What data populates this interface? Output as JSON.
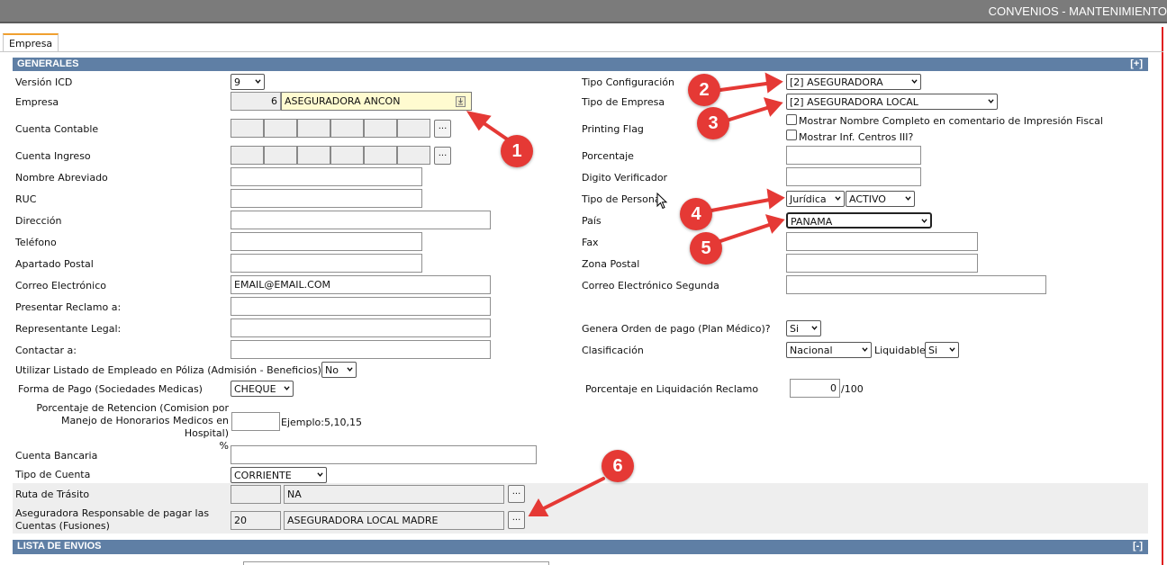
{
  "header": {
    "title": "CONVENIOS - MANTENIMIENTO"
  },
  "tabs": [
    {
      "label": "Empresa"
    }
  ],
  "sections": {
    "generales": {
      "title": "GENERALES",
      "toggle": "[+]"
    },
    "lista_envios": {
      "title": "LISTA DE ENVIOS",
      "toggle": "[-]"
    }
  },
  "left": {
    "version_icd": {
      "label": "Versión ICD",
      "value": "9"
    },
    "empresa": {
      "label": "Empresa",
      "code": "6",
      "name": "ASEGURADORA ANCON"
    },
    "cuenta_contable": {
      "label": "Cuenta Contable"
    },
    "cuenta_ingreso": {
      "label": "Cuenta Ingreso"
    },
    "nombre_abreviado": {
      "label": "Nombre Abreviado",
      "value": ""
    },
    "ruc": {
      "label": "RUC",
      "value": ""
    },
    "direccion": {
      "label": "Dirección",
      "value": ""
    },
    "telefono": {
      "label": "Teléfono",
      "value": ""
    },
    "apartado_postal": {
      "label": "Apartado Postal",
      "value": ""
    },
    "correo": {
      "label": "Correo Electrónico",
      "value": "EMAIL@EMAIL.COM"
    },
    "presentar_reclamo": {
      "label": "Presentar Reclamo a:",
      "value": ""
    },
    "representante_legal": {
      "label": "Representante Legal:",
      "value": ""
    },
    "contactar": {
      "label": "Contactar a:",
      "value": ""
    },
    "listado_empleado": {
      "label": "Utilizar Listado de Empleado en Póliza (Admisión - Beneficios):",
      "value": "No"
    },
    "forma_pago": {
      "label": "Forma de Pago (Sociedades Medicas)",
      "value": "CHEQUE"
    },
    "porcentaje_retencion": {
      "label_line1": "Porcentaje de Retencion (Comision por",
      "label_line2": "Manejo de Honorarios Medicos en Hospital)",
      "label_line3": "%",
      "value": "",
      "example": "Ejemplo:5,10,15"
    },
    "cuenta_bancaria": {
      "label": "Cuenta Bancaria",
      "value": ""
    },
    "tipo_cuenta": {
      "label": "Tipo de Cuenta",
      "value": "CORRIENTE"
    },
    "ruta_transito": {
      "label": "Ruta de Trásito",
      "code": "",
      "name": "NA"
    },
    "aseguradora_responsable": {
      "label_line1": "Aseguradora Responsable de pagar las",
      "label_line2": "Cuentas (Fusiones)",
      "code": "20",
      "name": "ASEGURADORA LOCAL MADRE"
    },
    "browse_label": "..."
  },
  "right": {
    "tipo_configuracion": {
      "label": "Tipo Configuración",
      "value": "[2] ASEGURADORA"
    },
    "tipo_empresa": {
      "label": "Tipo de Empresa",
      "value": "[2] ASEGURADORA LOCAL"
    },
    "printing_flag": {
      "label": "Printing Flag",
      "opt1": "Mostrar Nombre Completo en comentario de Impresión Fiscal",
      "opt2": "Mostrar Inf. Centros III?"
    },
    "porcentaje": {
      "label": "Porcentaje",
      "value": ""
    },
    "digito_verificador": {
      "label": "Digito Verificador",
      "value": ""
    },
    "tipo_persona": {
      "label": "Tipo de Persona",
      "value": "Jurídica",
      "estado": "ACTIVO"
    },
    "pais": {
      "label": "País",
      "value": "PANAMA"
    },
    "fax": {
      "label": "Fax",
      "value": ""
    },
    "zona_postal": {
      "label": "Zona Postal",
      "value": ""
    },
    "correo_segunda": {
      "label": "Correo Electrónico Segunda",
      "value": ""
    },
    "genera_orden": {
      "label": "Genera Orden de pago (Plan Médico)?",
      "value": "Si"
    },
    "clasificacion": {
      "label": "Clasificación",
      "value": "Nacional",
      "liquidable_label": "Liquidable",
      "liquidable_value": "Si"
    },
    "porcentaje_liquidacion": {
      "label": "Porcentaje en Liquidación Reclamo",
      "value": "0",
      "suffix": "/100"
    }
  },
  "annotations": [
    "1",
    "2",
    "3",
    "4",
    "5",
    "6"
  ],
  "colors": {
    "section": "#5f7fa5",
    "annotation": "#e53935",
    "topbar": "#7b7b7b"
  }
}
